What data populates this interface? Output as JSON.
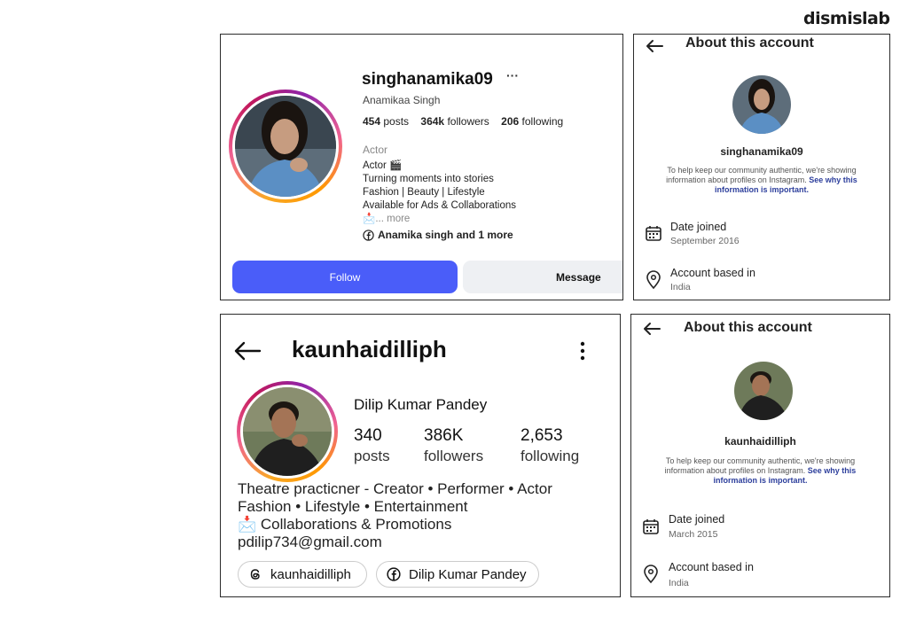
{
  "brand": "dismislab",
  "profile1": {
    "username": "singhanamika09",
    "more_label": "···",
    "full_name": "Anamikaa Singh",
    "posts_count": "454",
    "posts_label": "posts",
    "followers_count": "364k",
    "followers_label": "followers",
    "following_count": "206",
    "following_label": "following",
    "category": "Actor",
    "bio": [
      "Actor 🎬",
      "Turning moments into stories",
      "Fashion | Beauty | Lifestyle",
      "Available for Ads & Collaborations"
    ],
    "bio_more_emoji": "📩",
    "bio_more": "... more",
    "link_text": "Anamika singh and 1 more",
    "follow_label": "Follow",
    "message_label": "Message"
  },
  "about1": {
    "title": "About this account",
    "username": "singhanamika09",
    "info_line1": "To help keep our community authentic, we're showing",
    "info_line2": "information about profiles on Instagram.",
    "info_link1": "See why this",
    "info_link2": "information is important.",
    "date_joined_label": "Date joined",
    "date_joined_value": "September 2016",
    "based_label": "Account based in",
    "based_value": "India"
  },
  "profile2": {
    "username": "kaunhaidilliph",
    "full_name": "Dilip Kumar Pandey",
    "posts_count": "340",
    "posts_label": "posts",
    "followers_count": "386K",
    "followers_label": "followers",
    "following_count": "2,653",
    "following_label": "following",
    "bio": [
      "Theatre  practicner - Creator • Performer • Actor",
      "Fashion • Lifestyle • Entertainment",
      "📩 Collaborations & Promotions",
      "pdilip734@gmail.com"
    ],
    "threads_label": "kaunhaidilliph",
    "facebook_label": "Dilip Kumar Pandey"
  },
  "about2": {
    "title": "About this account",
    "username": "kaunhaidilliph",
    "info_line1": "To help keep our community authentic, we're showing",
    "info_line2": "information about profiles on Instagram.",
    "info_link1": "See why this",
    "info_link2": "information is important.",
    "date_joined_label": "Date joined",
    "date_joined_value": "March 2015",
    "based_label": "Account based in",
    "based_value": "India"
  },
  "icons": {
    "back": "back-arrow-icon",
    "calendar": "calendar-icon",
    "location": "location-pin-icon",
    "facebook": "facebook-icon",
    "threads": "threads-icon",
    "kebab": "more-vertical-icon"
  }
}
